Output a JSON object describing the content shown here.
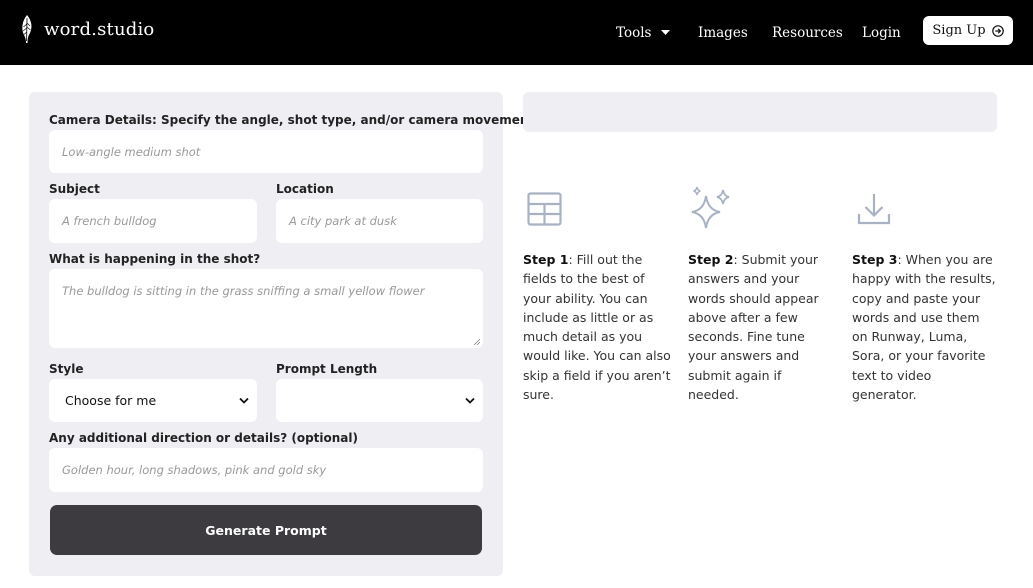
{
  "header": {
    "brand": "word.studio",
    "nav": {
      "tools": "Tools",
      "images": "Images",
      "resources": "Resources",
      "login": "Login"
    },
    "signup": "Sign Up"
  },
  "form": {
    "camera": {
      "label": "Camera Details: Specify the angle, shot type, and/or camera movement",
      "placeholder": "Low-angle medium shot"
    },
    "subject": {
      "label": "Subject",
      "placeholder": "A french bulldog"
    },
    "location": {
      "label": "Location",
      "placeholder": "A city park at dusk"
    },
    "happening": {
      "label": "What is happening in the shot?",
      "placeholder": "The bulldog is sitting in the grass sniffing a small yellow flower"
    },
    "style": {
      "label": "Style",
      "value": "Choose for me"
    },
    "length": {
      "label": "Prompt Length",
      "value": ""
    },
    "additional": {
      "label": "Any additional direction or details? (optional)",
      "placeholder": "Golden hour, long shadows, pink and gold sky"
    },
    "submit": "Generate Prompt"
  },
  "steps": [
    {
      "icon": "table-icon",
      "title": "Step 1",
      "text": ": Fill out the fields to the best of your ability. You can include as little or as much detail as you would like. You can also skip a field if you aren’t sure."
    },
    {
      "icon": "sparkles-icon",
      "title": "Step 2",
      "text": ": Submit your answers and your words should appear above after a few seconds. Fine tune your answers and submit again if needed."
    },
    {
      "icon": "download-icon",
      "title": "Step 3",
      "text": ": When you are happy with the results, copy and paste your words and use them on Runway, Luma, Sora, or your favorite text to video generator."
    }
  ],
  "colors": {
    "header_bg": "#000000",
    "panel_bg": "#efeef3",
    "button_bg": "#3d3b40",
    "icon": "#a9b2c3"
  }
}
